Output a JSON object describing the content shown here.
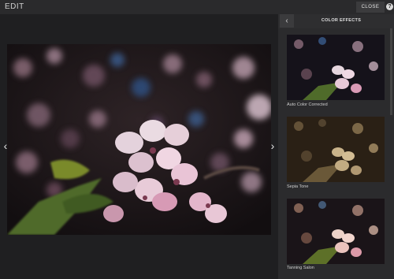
{
  "header": {
    "title": "EDIT",
    "close_label": "CLOSE",
    "help_label": "?"
  },
  "viewer": {
    "prev_label": "‹",
    "next_label": "›"
  },
  "panel": {
    "back_label": "‹",
    "title": "COLOR EFFECTS",
    "effects": [
      {
        "label": "Auto Color Corrected",
        "filter": "none"
      },
      {
        "label": "Sepia Tone",
        "filter": "sepia"
      },
      {
        "label": "Tanning Salon",
        "filter": "warm"
      }
    ]
  },
  "colors": {
    "background": "#1e1e20",
    "topbar": "#2a2a2c",
    "panel": "#2b2b2d",
    "petal": "#e9c4d6",
    "leaf": "#4f6b2a"
  }
}
